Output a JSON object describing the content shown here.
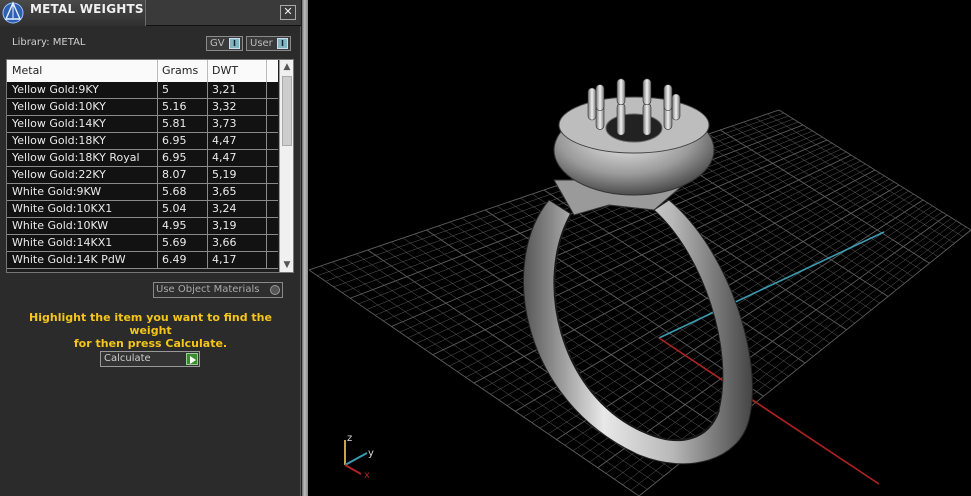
{
  "window": {
    "title": "METAL WEIGHTS",
    "close_label": "✕"
  },
  "library": {
    "label": "Library: METAL"
  },
  "toggles": [
    {
      "label": "GV",
      "knob": "I"
    },
    {
      "label": "User",
      "knob": "I"
    }
  ],
  "table": {
    "columns": [
      "Metal",
      "Grams",
      "DWT"
    ],
    "rows": [
      [
        "Yellow Gold:9KY",
        "5",
        "3,21"
      ],
      [
        "Yellow Gold:10KY",
        "5.16",
        "3,32"
      ],
      [
        "Yellow Gold:14KY",
        "5.81",
        "3,73"
      ],
      [
        "Yellow Gold:18KY",
        "6.95",
        "4,47"
      ],
      [
        "Yellow Gold:18KY Royal",
        "6.95",
        "4,47"
      ],
      [
        "Yellow Gold:22KY",
        "8.07",
        "5,19"
      ],
      [
        "White Gold:9KW",
        "5.68",
        "3,65"
      ],
      [
        "White Gold:10KX1",
        "5.04",
        "3,24"
      ],
      [
        "White Gold:10KW",
        "4.95",
        "3,19"
      ],
      [
        "White Gold:14KX1",
        "5.69",
        "3,66"
      ],
      [
        "White Gold:14K PdW",
        "6.49",
        "4,17"
      ]
    ]
  },
  "use_object": {
    "label": "Use Object Materials"
  },
  "hint": {
    "line1": "Highlight the item you want to find the weight",
    "line2": "for then press Calculate."
  },
  "calculate": {
    "label": "Calculate"
  },
  "axes": {
    "z": "z",
    "y": "y",
    "x": "x"
  },
  "colors": {
    "hint": "#f5c518",
    "y_axis": "#3a9bb0",
    "x_axis": "#b02222",
    "grid": "#6e6e6e"
  }
}
